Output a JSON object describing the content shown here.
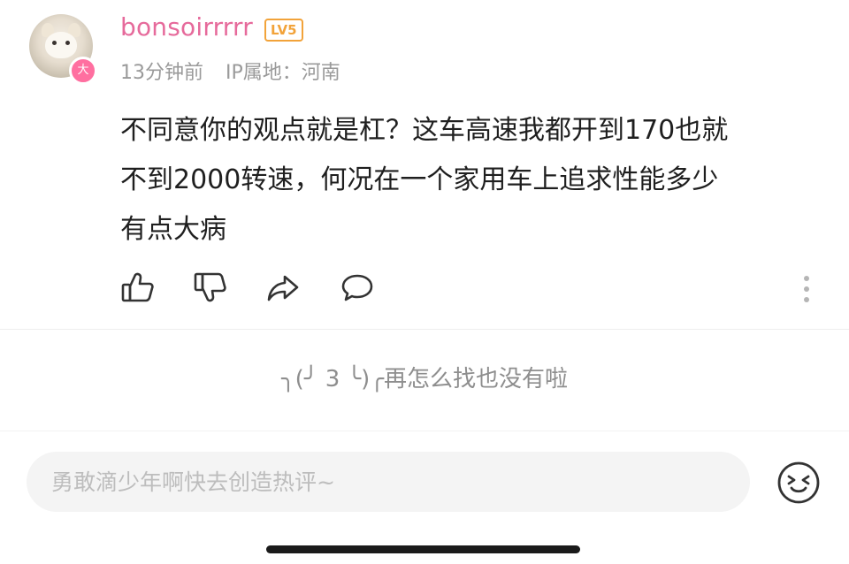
{
  "comment": {
    "username": "bonsoirrrrr",
    "level": "LV5",
    "avatar_badge": "大",
    "time": "13分钟前",
    "ip_location": "IP属地：河南",
    "text_lines": [
      "不同意你的观点就是杠？这车高速我都开到170也就",
      "不到2000转速，何况在一个家用车上追求性能多少",
      "有点大病"
    ],
    "actions": [
      "like-icon",
      "dislike-icon",
      "share-icon",
      "reply-icon",
      "more-icon"
    ]
  },
  "end_message": "╮(╯ 3 ╰)╭再怎么找也没有啦",
  "input": {
    "placeholder": "勇敢滴少年啊快去创造热评~"
  },
  "colors": {
    "username": "#e66a9b",
    "level_badge": "#f2a33a",
    "meta_text": "#9a9a9a",
    "input_bg": "#f4f4f4"
  }
}
